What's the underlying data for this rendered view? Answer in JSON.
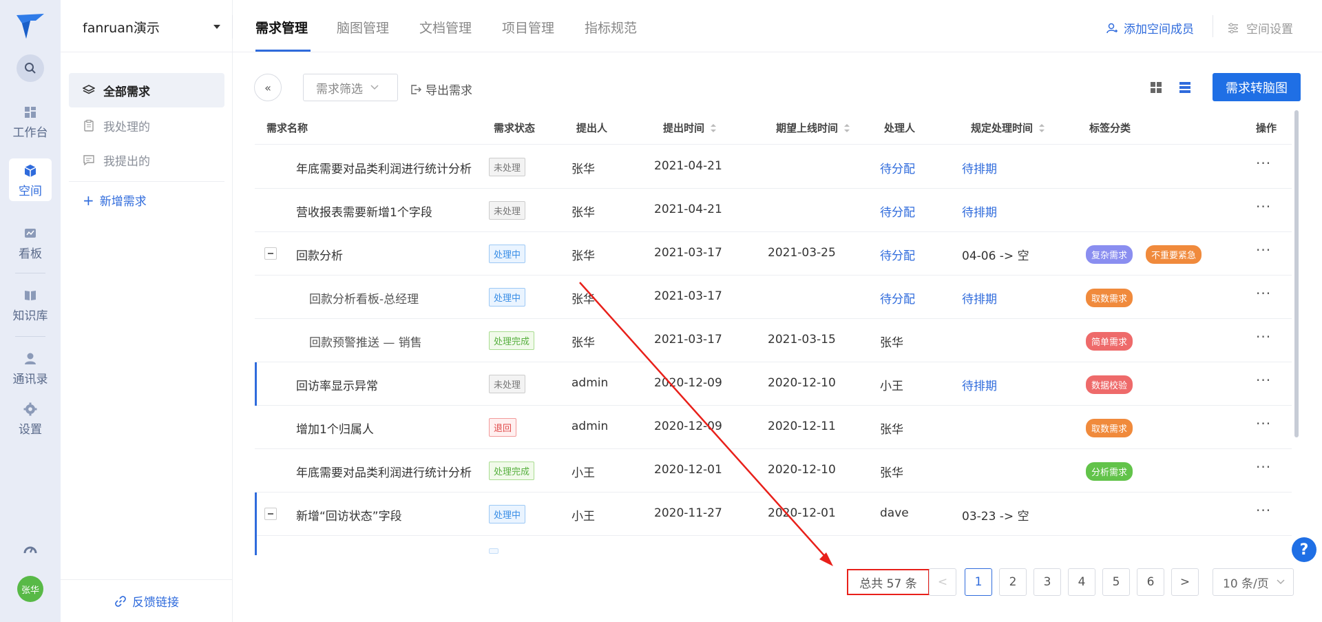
{
  "rail": {
    "items": [
      {
        "label": "工作台",
        "icon": "dashboard-icon"
      },
      {
        "label": "空间",
        "icon": "cube-icon"
      },
      {
        "label": "看板",
        "icon": "chart-board-icon"
      },
      {
        "label": "知识库",
        "icon": "book-icon"
      },
      {
        "label": "通讯录",
        "icon": "contact-icon"
      },
      {
        "label": "设置",
        "icon": "gear-icon"
      }
    ],
    "avatar": "张华"
  },
  "sidebar": {
    "workspace": "fanruan演示",
    "items": [
      {
        "label": "全部需求",
        "icon": "layers-icon"
      },
      {
        "label": "我处理的",
        "icon": "clipboard-icon"
      },
      {
        "label": "我提出的",
        "icon": "comment-icon"
      }
    ],
    "add_label": "新增需求",
    "feedback_label": "反馈链接"
  },
  "topnav": {
    "tabs": [
      "需求管理",
      "脑图管理",
      "文档管理",
      "项目管理",
      "指标规范"
    ],
    "add_member": "添加空间成员",
    "settings": "空间设置"
  },
  "toolbar": {
    "filter": "需求筛选",
    "export": "导出需求",
    "convert": "需求转脑图"
  },
  "table": {
    "columns": [
      "需求名称",
      "需求状态",
      "提出人",
      "提出时间",
      "期望上线时间",
      "处理人",
      "规定处理时间",
      "标签分类",
      "操作"
    ],
    "rows": [
      {
        "name": "年底需要对品类利润进行统计分析",
        "status": "未处理",
        "submitter": "张华",
        "submitted": "2021-04-21",
        "expected": "",
        "handler": "待分配",
        "deadline": "待排期",
        "tags": []
      },
      {
        "name": "营收报表需要新增1个字段",
        "status": "未处理",
        "submitter": "张华",
        "submitted": "2021-04-21",
        "expected": "",
        "handler": "待分配",
        "deadline": "待排期",
        "tags": []
      },
      {
        "name": "回款分析",
        "status": "处理中",
        "submitter": "张华",
        "submitted": "2021-03-17",
        "expected": "2021-03-25",
        "handler": "待分配",
        "deadline": "04-06 -> 空",
        "tags": [
          "复杂需求",
          "不重要紧急"
        ]
      },
      {
        "name": "回款分析看板-总经理",
        "status": "处理中",
        "submitter": "张华",
        "submitted": "2021-03-17",
        "expected": "",
        "handler": "待分配",
        "deadline": "待排期",
        "tags": [
          "取数需求"
        ]
      },
      {
        "name": "回款预警推送 — 销售",
        "status": "处理完成",
        "submitter": "张华",
        "submitted": "2021-03-17",
        "expected": "2021-03-15",
        "handler": "张华",
        "deadline": "",
        "tags": [
          "简单需求"
        ]
      },
      {
        "name": "回访率显示异常",
        "status": "未处理",
        "submitter": "admin",
        "submitted": "2020-12-09",
        "expected": "2020-12-10",
        "handler": "小王",
        "deadline": "待排期",
        "tags": [
          "数据校验"
        ]
      },
      {
        "name": "增加1个归属人",
        "status": "退回",
        "submitter": "admin",
        "submitted": "2020-12-09",
        "expected": "2020-12-11",
        "handler": "张华",
        "deadline": "",
        "tags": [
          "取数需求"
        ]
      },
      {
        "name": "年底需要对品类利润进行统计分析",
        "status": "处理完成",
        "submitter": "小王",
        "submitted": "2020-12-01",
        "expected": "2020-12-10",
        "handler": "张华",
        "deadline": "",
        "tags": [
          "分析需求"
        ]
      },
      {
        "name": "新增“回访状态”字段",
        "status": "处理中",
        "submitter": "小王",
        "submitted": "2020-11-27",
        "expected": "2020-12-01",
        "handler": "dave",
        "deadline": "03-23 -> 空",
        "tags": []
      }
    ]
  },
  "pagination": {
    "total": "总共 57 条",
    "prev": "<",
    "pages": [
      "1",
      "2",
      "3",
      "4",
      "5",
      "6"
    ],
    "next": ">",
    "per_page": "10 条/页"
  },
  "help": "?",
  "colors": {
    "primary": "#1f6fe5",
    "annotation": "#e8201a",
    "tag_purple": "#8a8ef0",
    "tag_orange": "#f08a3c",
    "tag_red": "#ee6a6a",
    "tag_green": "#62c34a"
  }
}
